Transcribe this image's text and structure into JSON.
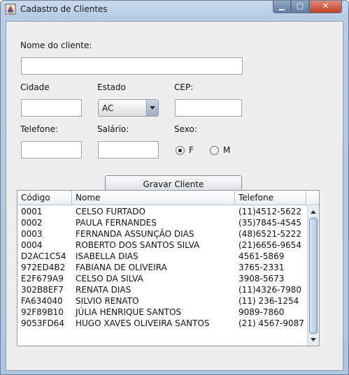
{
  "window": {
    "title": "Cadastro de Clientes"
  },
  "form": {
    "nome_label": "Nome do cliente:",
    "nome_value": "",
    "cidade_label": "Cidade",
    "cidade_value": "",
    "estado_label": "Estado",
    "estado_value": "AC",
    "cep_label": "CEP:",
    "cep_value": "",
    "telefone_label": "Telefone:",
    "telefone_value": "",
    "salario_label": "Salário:",
    "salario_value": "",
    "sexo_label": "Sexo:",
    "sexo_options": [
      "F",
      "M"
    ],
    "sexo_selected": "F",
    "save_label": "Gravar Cliente"
  },
  "table": {
    "headers": [
      "Código",
      "Nome",
      "Telefone"
    ],
    "rows": [
      [
        "0001",
        "CELSO FURTADO",
        "(11)4512-5622"
      ],
      [
        "0002",
        "PAULA FERNANDES",
        "(35)7845-4545"
      ],
      [
        "0003",
        "FERNANDA ASSUNÇÃO DIAS",
        "(48)6521-5222"
      ],
      [
        "0004",
        "ROBERTO DOS SANTOS SILVA",
        "(21)6656-9654"
      ],
      [
        "D2AC1C54",
        "ISABELLA DIAS",
        "4561-5869"
      ],
      [
        "972ED4B2",
        "FABIANA DE OLIVEIRA",
        "3765-2331"
      ],
      [
        "E2F679A9",
        "CELSO DA SILVA",
        "3908-5673"
      ],
      [
        "302B8EF7",
        "RENATA DIAS",
        "(11)4326-7980"
      ],
      [
        "FA634040",
        "SILVIO RENATO",
        "(11) 236-1254"
      ],
      [
        "92F89B10",
        "JÚLIA HENRIQUE SANTOS",
        "9089-7860"
      ],
      [
        "9053FD64",
        "HUGO XAVES OLIVEIRA SANTOS",
        "(21) 4567-9087"
      ]
    ]
  },
  "icons": {
    "app": "app-icon",
    "minimize": "minimize-icon",
    "maximize": "maximize-icon",
    "close": "close-icon"
  }
}
